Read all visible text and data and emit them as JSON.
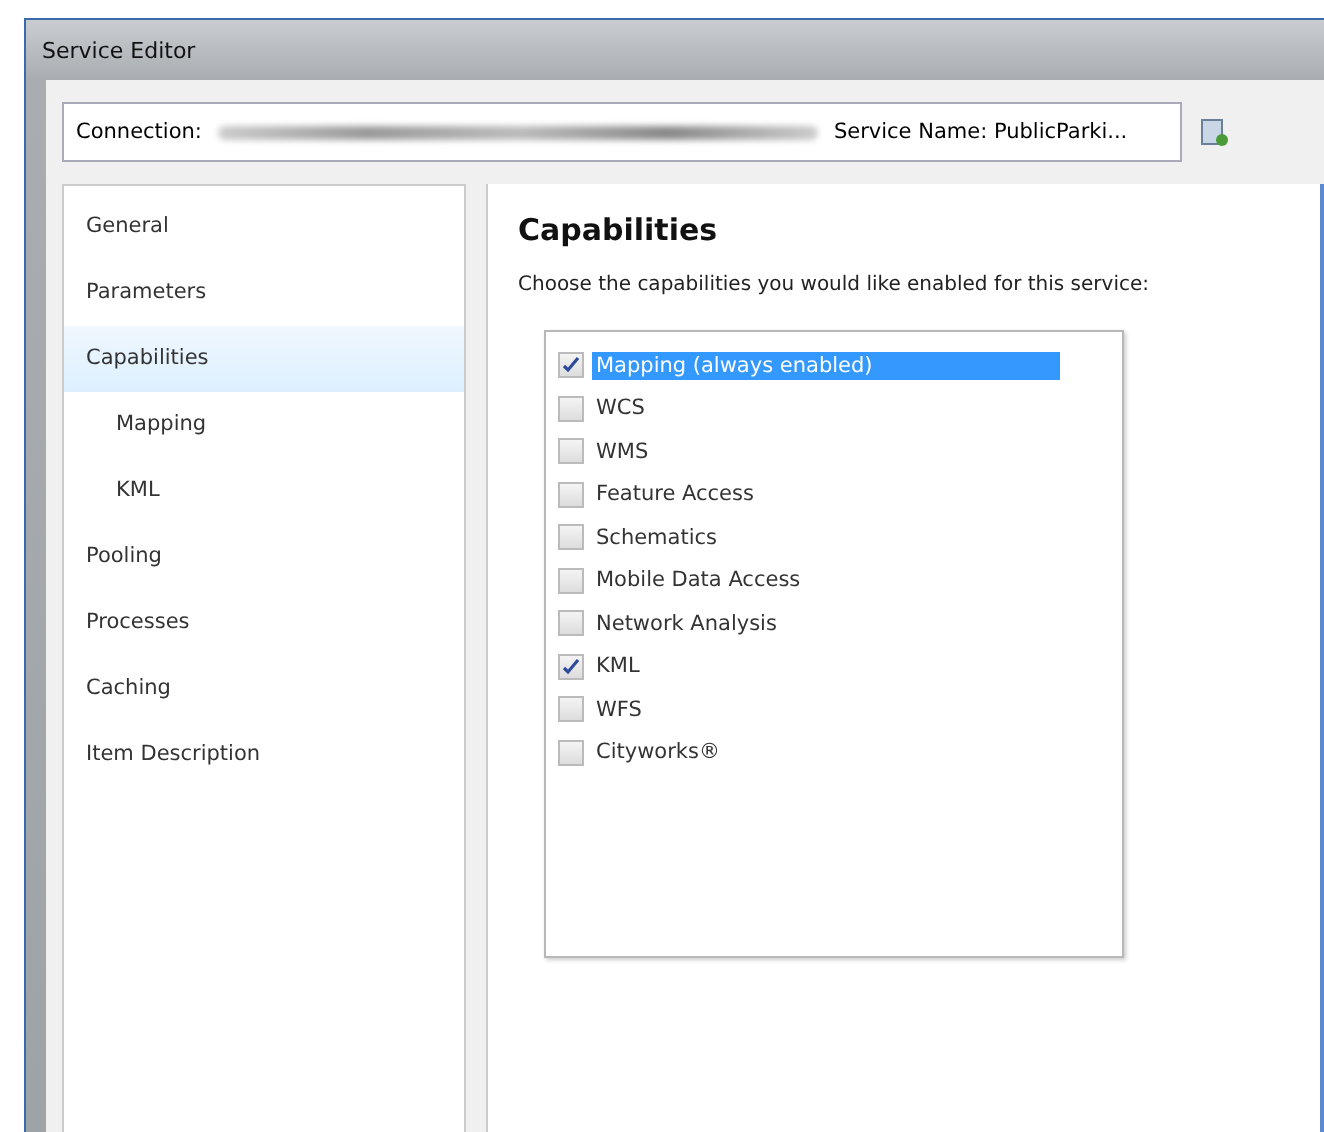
{
  "window": {
    "title": "Service Editor"
  },
  "connection_bar": {
    "connection_label": "Connection:",
    "service_name": "Service Name: PublicParki..."
  },
  "sidebar": {
    "items": [
      {
        "label": "General",
        "selected": false
      },
      {
        "label": "Parameters",
        "selected": false
      },
      {
        "label": "Capabilities",
        "selected": true,
        "children": [
          {
            "label": "Mapping",
            "selected": false
          },
          {
            "label": "KML",
            "selected": false
          }
        ]
      },
      {
        "label": "Pooling",
        "selected": false
      },
      {
        "label": "Processes",
        "selected": false
      },
      {
        "label": "Caching",
        "selected": false
      },
      {
        "label": "Item Description",
        "selected": false
      }
    ]
  },
  "content": {
    "heading": "Capabilities",
    "instruction": "Choose the capabilities you would like enabled for this service:",
    "capabilities": [
      {
        "label": "Mapping (always enabled)",
        "checked": true,
        "selected": true
      },
      {
        "label": "WCS",
        "checked": false,
        "selected": false
      },
      {
        "label": "WMS",
        "checked": false,
        "selected": false
      },
      {
        "label": "Feature Access",
        "checked": false,
        "selected": false
      },
      {
        "label": "Schematics",
        "checked": false,
        "selected": false
      },
      {
        "label": "Mobile Data Access",
        "checked": false,
        "selected": false
      },
      {
        "label": "Network Analysis",
        "checked": false,
        "selected": false
      },
      {
        "label": "KML",
        "checked": true,
        "selected": false
      },
      {
        "label": "WFS",
        "checked": false,
        "selected": false
      },
      {
        "label": "Cityworks®",
        "checked": false,
        "selected": false
      }
    ]
  }
}
